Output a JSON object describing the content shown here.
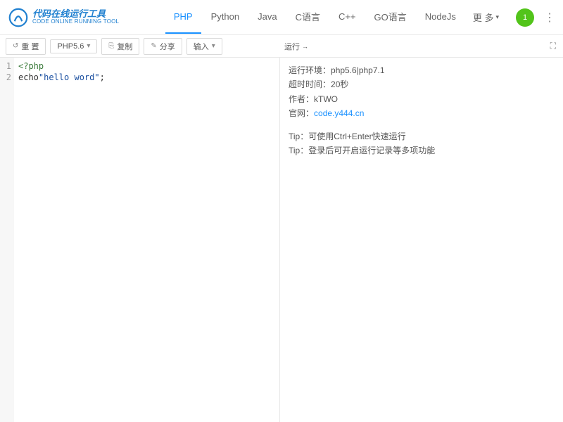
{
  "logo": {
    "cn": "代码在线运行工具",
    "en": "CODE ONLINE RUNNING TOOL"
  },
  "nav": {
    "tabs": [
      "PHP",
      "Python",
      "Java",
      "C语言",
      "C++",
      "GO语言",
      "NodeJs"
    ],
    "active": 0,
    "more": "更 多"
  },
  "avatar": "1",
  "toolbar": {
    "reset": "重 置",
    "version": "PHP5.6",
    "copy": "复制",
    "share": "分享",
    "input": "输入",
    "run": "运行"
  },
  "code": {
    "lines": [
      "1",
      "2"
    ],
    "line1_kw": "<?php",
    "line2_a": "echo",
    "line2_b": "\"hello word\"",
    "line2_c": ";"
  },
  "output": {
    "env_label": "运行环境：",
    "env_value": "php5.6|php7.1",
    "timeout_label": "超时时间：",
    "timeout_value": "20秒",
    "author_label": "作者：",
    "author_value": "kTWO",
    "site_label": "官网：",
    "site_value": "code.y444.cn",
    "tip1": "Tip：可使用Ctrl+Enter快速运行",
    "tip2": "Tip：登录后可开启运行记录等多项功能"
  }
}
